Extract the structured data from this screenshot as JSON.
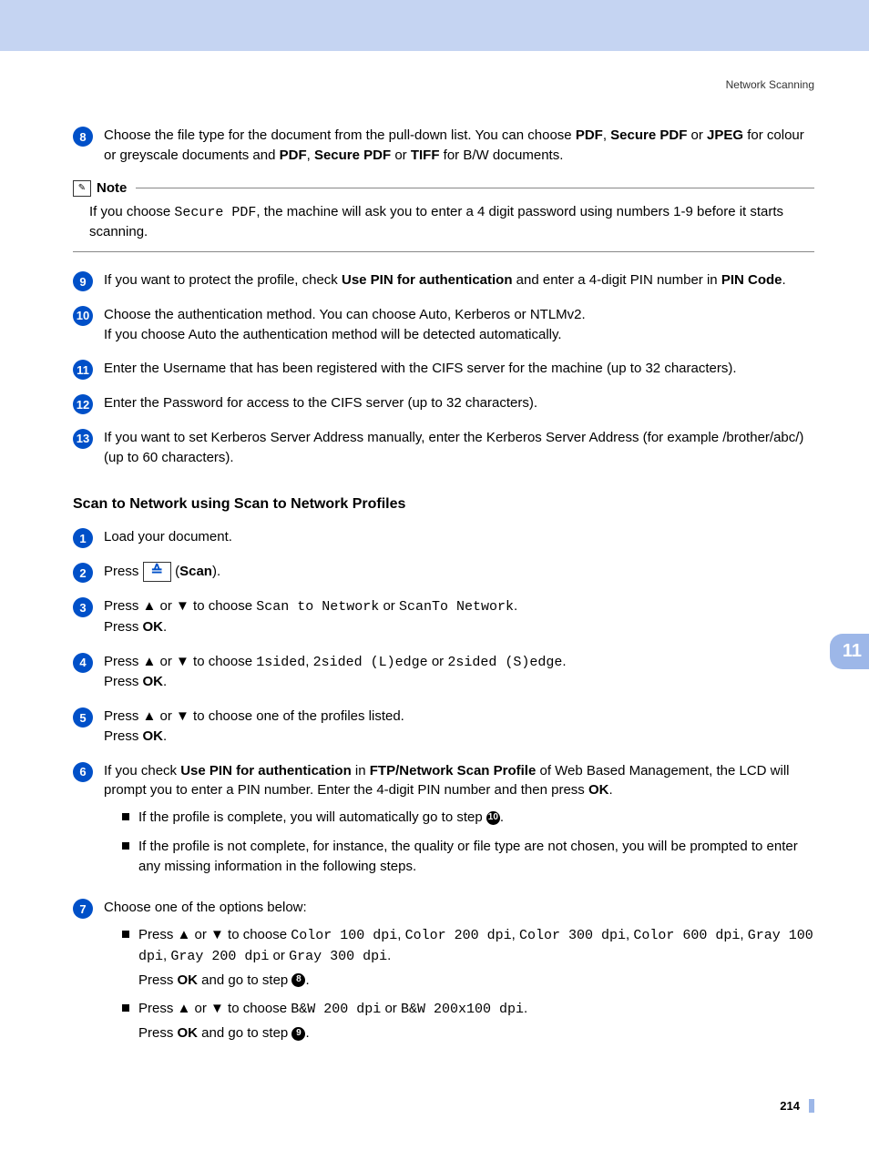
{
  "header": {
    "section_title": "Network Scanning"
  },
  "steps_a": [
    {
      "num": "8",
      "html": "Choose the file type for the document from the pull-down list. You can choose <b>PDF</b>, <b>Secure PDF</b> or <b>JPEG</b> for colour or greyscale documents and <b>PDF</b>, <b>Secure PDF</b> or <b>TIFF</b> for B/W documents."
    }
  ],
  "note": {
    "title": "Note",
    "body_html": "If you choose <span class='mono'>Secure PDF</span>, the machine will ask you to enter a 4 digit password using numbers 1-9 before it starts scanning."
  },
  "steps_b": [
    {
      "num": "9",
      "html": "If you want to protect the profile, check <b>Use PIN for authentication</b> and enter a 4-digit PIN number in <b>PIN Code</b>."
    },
    {
      "num": "10",
      "html": "Choose the authentication method. You can choose Auto, Kerberos or NTLMv2.<br>If you choose Auto the authentication method will be detected automatically."
    },
    {
      "num": "11",
      "html": "Enter the Username that has been registered with the CIFS server for the machine (up to 32 characters)."
    },
    {
      "num": "12",
      "html": "Enter the Password for access to the CIFS server (up to 32 characters)."
    },
    {
      "num": "13",
      "html": "If you want to set Kerberos Server Address manually, enter the Kerberos Server Address (for example /brother/abc/) (up to 60 characters)."
    }
  ],
  "section_heading": "Scan to Network using Scan to Network Profiles",
  "steps_c": [
    {
      "num": "1",
      "html": "Load your document."
    },
    {
      "num": "2",
      "html": "Press <span class='scan-btn' data-name='scan-button-icon' data-interactable='false'>≙</span> (<b>Scan</b>)."
    },
    {
      "num": "3",
      "html": "Press ▲ or ▼ to choose <span class='mono'>Scan to Network</span> or <span class='mono'>ScanTo Network</span>.<br>Press <b>OK</b>."
    },
    {
      "num": "4",
      "html": "Press ▲ or ▼ to choose <span class='mono'>1sided</span>, <span class='mono'>2sided (L)edge</span> or <span class='mono'>2sided (S)edge</span>.<br>Press <b>OK</b>."
    },
    {
      "num": "5",
      "html": "Press ▲ or ▼ to choose one of the profiles listed.<br>Press <b>OK</b>."
    },
    {
      "num": "6",
      "html": "If you check <b>Use PIN for authentication</b> in <b>FTP/Network Scan Profile</b> of Web Based Management, the LCD will prompt you to enter a PIN number. Enter the 4-digit PIN number and then press <b>OK</b>.",
      "bullets": [
        {
          "html": "If the profile is complete, you will automatically go to step <span class='inline-num' data-name='step-ref-10-icon'>10</span>."
        },
        {
          "html": "If the profile is not complete, for instance, the quality or file type are not chosen, you will be prompted to enter any missing information in the following steps."
        }
      ]
    },
    {
      "num": "7",
      "html": "Choose one of the options below:",
      "bullets": [
        {
          "html": "Press ▲ or ▼ to choose <span class='mono'>Color 100 dpi</span>, <span class='mono'>Color 200 dpi</span>, <span class='mono'>Color 300 dpi</span>, <span class='mono'>Color 600 dpi</span>, <span class='mono'>Gray 100 dpi</span>, <span class='mono'>Gray 200 dpi</span> or <span class='mono'>Gray 300 dpi</span>.",
          "after_html": "Press <b>OK</b> and go to step <span class='inline-num' data-name='step-ref-8-icon'>8</span>."
        },
        {
          "html": "Press ▲ or ▼ to choose <span class='mono'>B&amp;W 200 dpi</span> or <span class='mono'>B&amp;W 200x100 dpi</span>.",
          "after_html": "Press <b>OK</b> and go to step <span class='inline-num' data-name='step-ref-9-icon'>9</span>."
        }
      ]
    }
  ],
  "chapter_tab": "11",
  "page_number": "214"
}
